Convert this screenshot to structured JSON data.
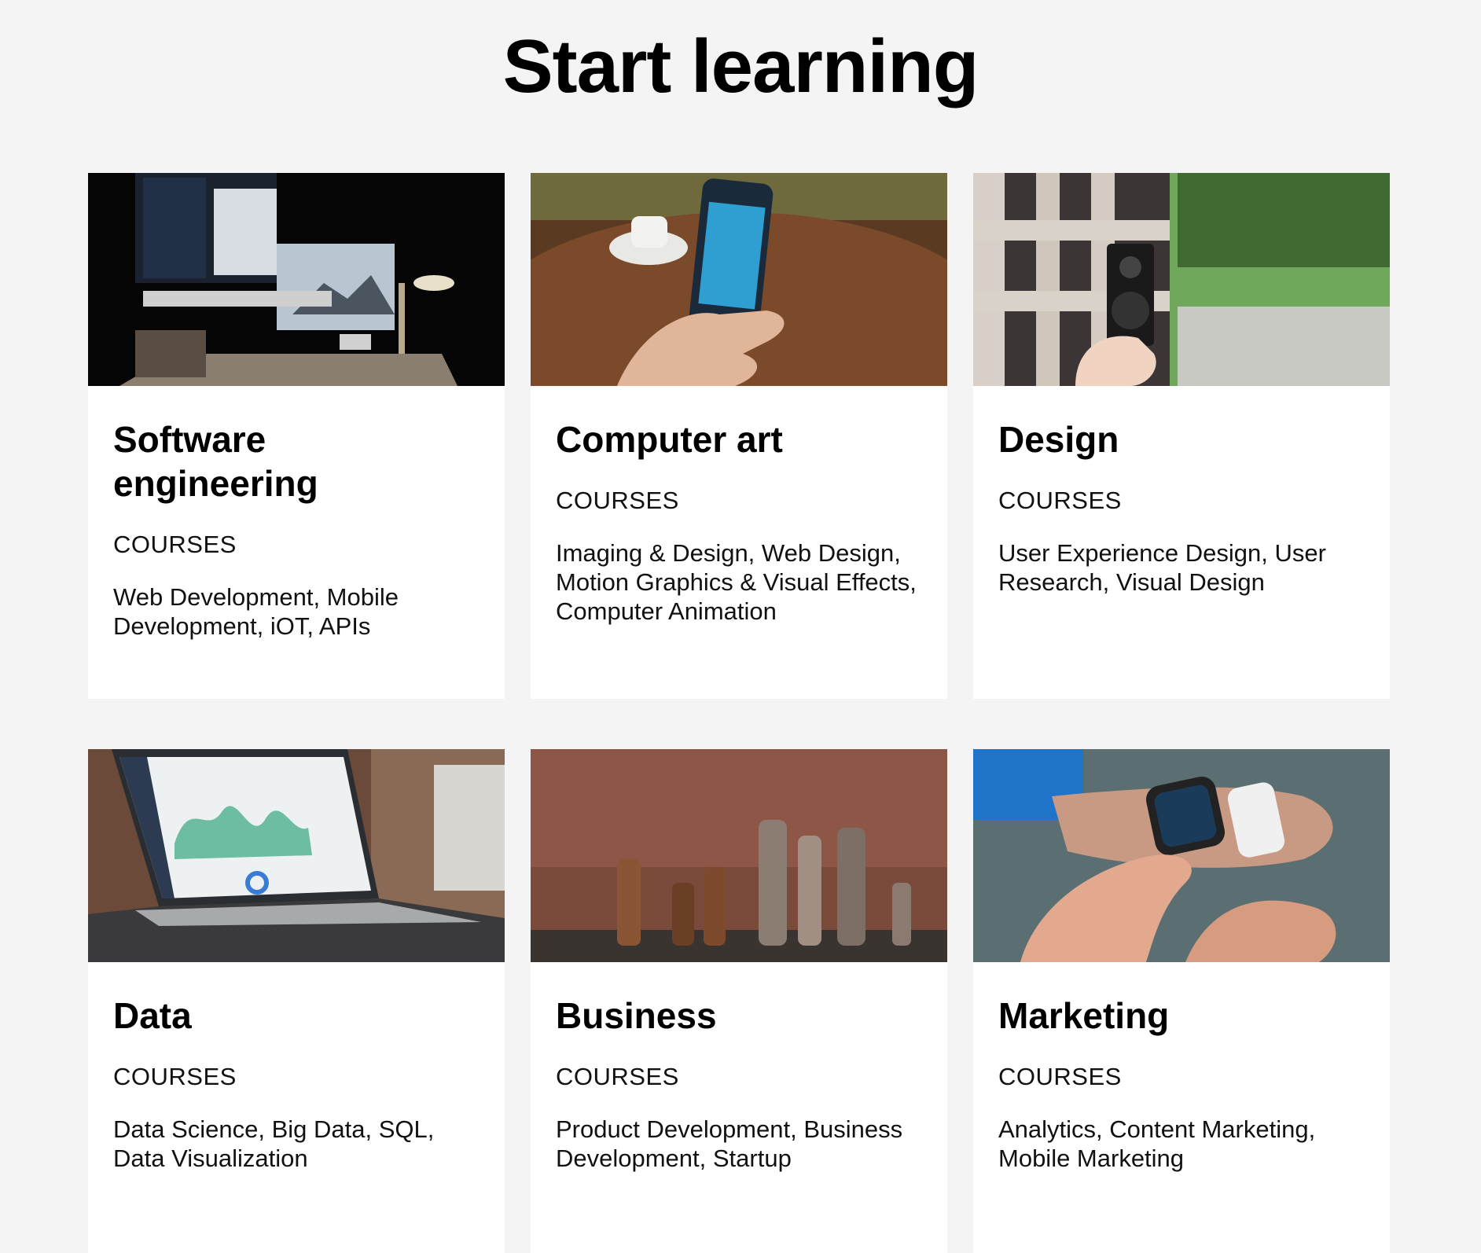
{
  "page": {
    "title": "Start learning"
  },
  "categories": [
    {
      "title": "Software engineering",
      "courses_label": "COURSES",
      "courses": "Web Development, Mobile Development, iOT, APIs",
      "image_icon": "desk-computers-photo"
    },
    {
      "title": "Computer art",
      "courses_label": "COURSES",
      "courses": "Imaging & Design, Web Design, Motion Graphics & Visual Effects, Computer Animation",
      "image_icon": "phone-in-hand-photo"
    },
    {
      "title": "Design",
      "courses_label": "COURSES",
      "courses": "User Experience Design, User Research, Visual Design",
      "image_icon": "camera-photo"
    },
    {
      "title": "Data",
      "courses_label": "COURSES",
      "courses": "Data Science, Big Data, SQL, Data Visualization",
      "image_icon": "laptop-dashboard-photo"
    },
    {
      "title": "Business",
      "courses_label": "COURSES",
      "courses": "Product Development, Business Development, Startup",
      "image_icon": "chess-pieces-photo"
    },
    {
      "title": "Marketing",
      "courses_label": "COURSES",
      "courses": "Analytics, Content Marketing, Mobile Marketing",
      "image_icon": "smartwatch-photo"
    }
  ]
}
